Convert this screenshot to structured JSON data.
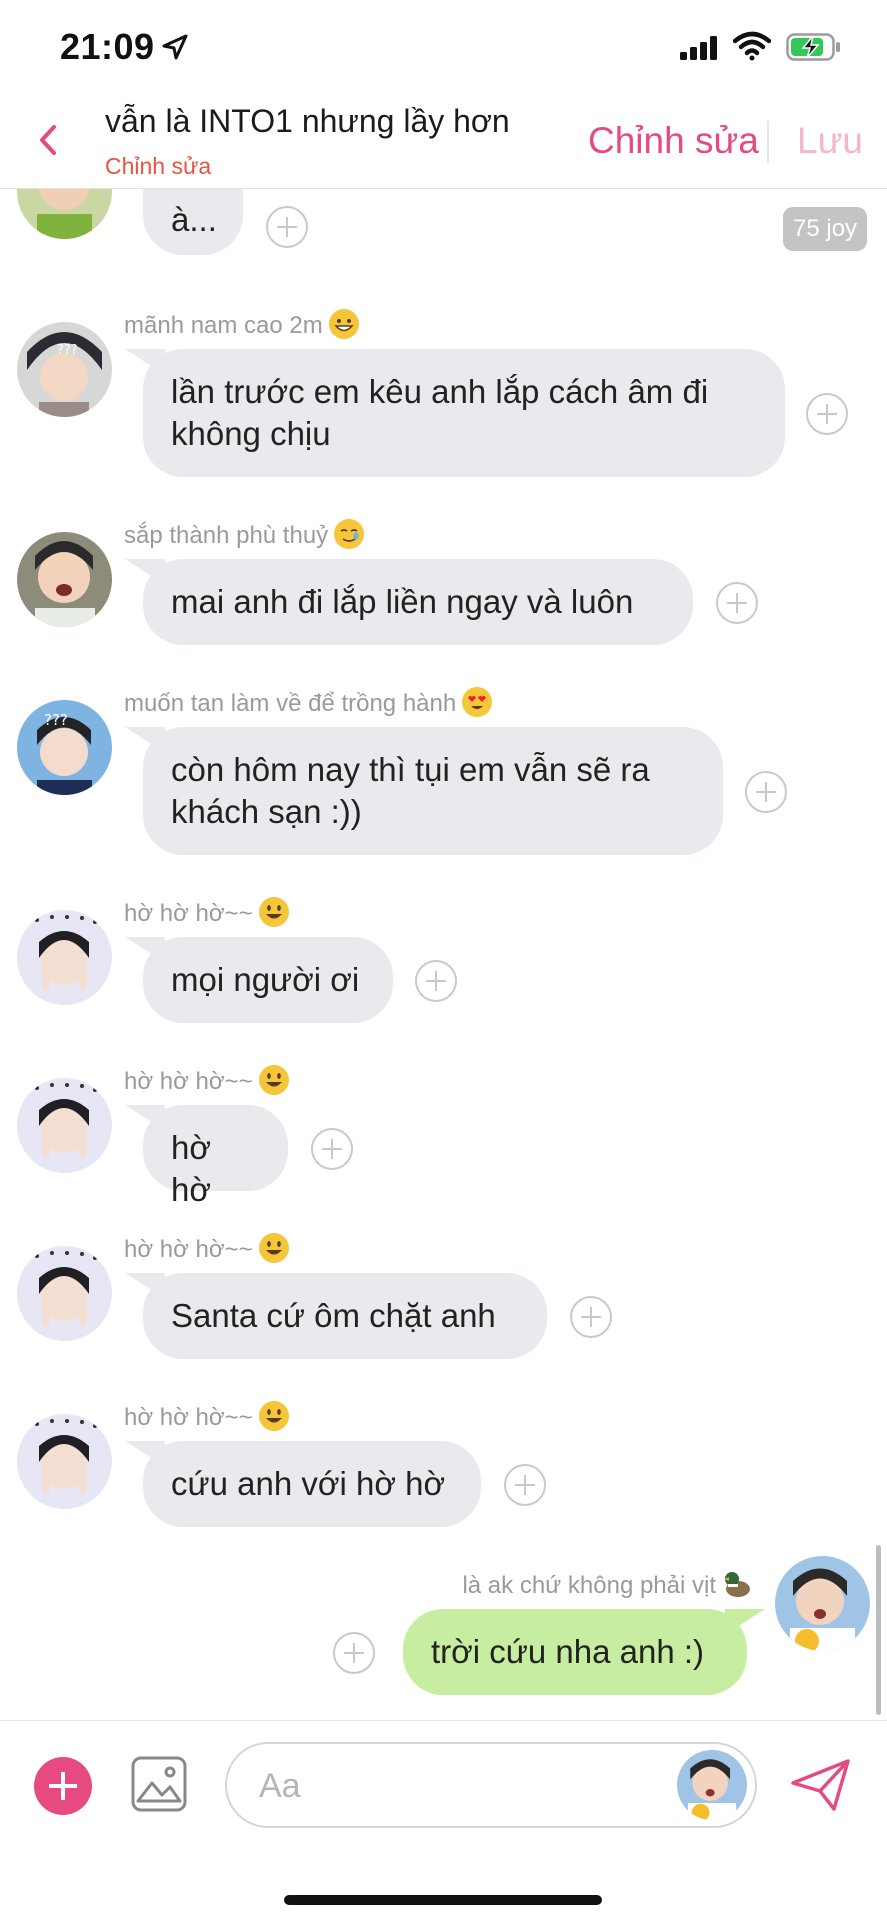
{
  "status_bar": {
    "time": "21:09"
  },
  "header": {
    "title": "vẫn là INTO1 nhưng lầy hơn",
    "subtitle": "Chỉnh sửa",
    "edit_label": "Chỉnh sửa",
    "save_label": "Lưu",
    "accent_color": "#e54b83"
  },
  "messages": [
    {
      "sender": "",
      "text": "à...",
      "badge": "75 joy"
    },
    {
      "sender": "mãnh nam cao 2m",
      "text_lines": [
        "lần trước em kêu anh lắp cách âm đi",
        "không chịu"
      ]
    },
    {
      "sender": "sắp thành phù thuỷ",
      "text": "mai anh đi lắp liền ngay và luôn"
    },
    {
      "sender": "muốn tan làm về để trồng hành",
      "text_lines": [
        "còn hôm nay thì tụi em vẫn sẽ ra",
        "khách sạn :))"
      ]
    },
    {
      "sender": "hờ hờ hờ~~",
      "text": "mọi người ơi"
    },
    {
      "sender": "hờ hờ hờ~~",
      "text": "hờ hờ"
    },
    {
      "sender": "hờ hờ hờ~~",
      "text": "Santa cứ ôm chặt anh"
    },
    {
      "sender": "hờ hờ hờ~~",
      "text": "cứu anh với hờ hờ"
    },
    {
      "sender": "là ak chứ không phải vịt",
      "text": "trời cứu nha anh :)",
      "mine": true
    }
  ],
  "composer": {
    "placeholder": "Aa"
  },
  "colors": {
    "bubble_other": "#e9eaee",
    "bubble_mine": "#c7eda0",
    "add_button": "#e64a80"
  }
}
